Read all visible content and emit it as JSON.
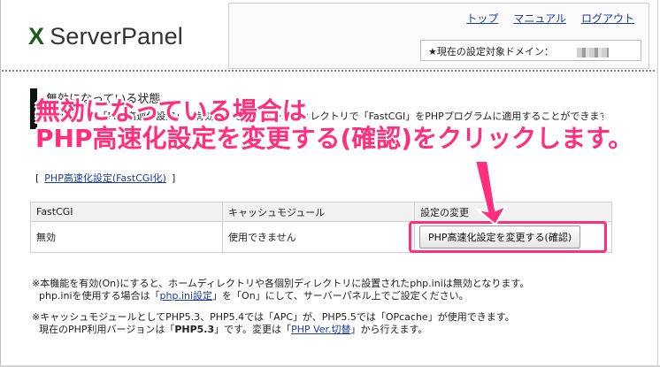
{
  "logo": {
    "x": "X",
    "text": "ServerPanel"
  },
  "toplinks": [
    "トップ",
    "マニュアル",
    "ログアウト"
  ],
  "domain": {
    "label": "★現在の設定対象ドメイン："
  },
  "section": {
    "title": "無効になっている状態",
    "desc": "「FastCGI」で「PHP高速化設定」を有効にすると、ホームディレクトリで「FastCGI」をPHPプログラムに適用することができます。多"
  },
  "overlay": {
    "line1": "無効になっている場合は",
    "line2": "PHP高速化設定を変更する(確認)をクリックします。"
  },
  "fastcgi_link": {
    "open": "[",
    "text": "PHP高速化設定(FastCGI化)",
    "close": "]"
  },
  "table": {
    "headers": [
      "FastCGI",
      "キャッシュモジュール",
      "設定の変更"
    ],
    "row": {
      "fastcgi": "無効",
      "cache": "使用できません",
      "button": "PHP高速化設定を変更する(確認)"
    }
  },
  "notes": {
    "n1_line1": "※本機能を有効(On)にすると、ホームディレクトリや各個別ディレクトリに設置されたphp.iniは無効となります。",
    "n1_line2_pre": "php.iniを使用する場合は「",
    "n1_link": "php.ini設定",
    "n1_line2_post": "」を「On」にして、サーバーパネル上でご設定ください。",
    "n2_line1": "※キャッシュモジュールとしてPHP5.3、PHP5.4では「APC」が、PHP5.5では「OPcache」が使用できます。",
    "n2_line2_pre": "現在のPHP利用バージョンは「",
    "n2_version": "PHP5.3",
    "n2_line2_mid": "」です。変更は「",
    "n2_link": "PHP Ver.切替",
    "n2_line2_post": "」から行えます。"
  },
  "colors": {
    "accent": "#ff2f7e",
    "link": "#1a3d9c",
    "logo_x": "#1f5a1a"
  }
}
